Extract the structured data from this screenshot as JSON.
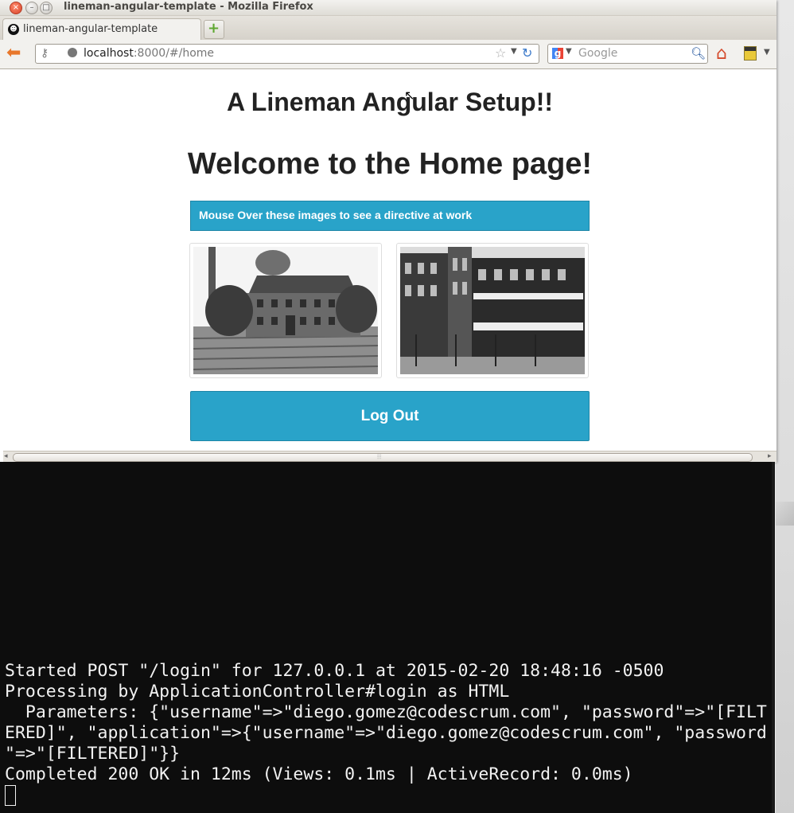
{
  "window": {
    "title": "lineman-angular-template - Mozilla Firefox"
  },
  "tab": {
    "label": "lineman-angular-template",
    "new_tab_symbol": "+"
  },
  "navbar": {
    "url_host": "localhost",
    "url_rest": ":8000/#/home",
    "search_placeholder": "Google",
    "search_engine_letter": "g"
  },
  "page": {
    "title": "A Lineman Angular Setup!!",
    "subtitle": "Welcome to the Home page!",
    "banner": "Mouse Over these images to see a directive at work",
    "images": [
      {
        "icon": "old-mill-photo"
      },
      {
        "icon": "old-storefront-photo"
      }
    ],
    "logout_label": "Log Out"
  },
  "terminal": {
    "lines": [
      "Started POST \"/login\" for 127.0.0.1 at 2015-02-20 18:48:16 -0500",
      "Processing by ApplicationController#login as HTML",
      "  Parameters: {\"username\"=>\"diego.gomez@codescrum.com\", \"password\"=>\"[FILT",
      "ERED]\", \"application\"=>{\"username\"=>\"diego.gomez@codescrum.com\", \"password",
      "\"=>\"[FILTERED]\"}}",
      "Completed 200 OK in 12ms (Views: 0.1ms | ActiveRecord: 0.0ms)"
    ]
  },
  "colors": {
    "accent": "#29a3c9",
    "terminal_bg": "#0d0d0d",
    "terminal_fg": "#f2f2f2"
  }
}
